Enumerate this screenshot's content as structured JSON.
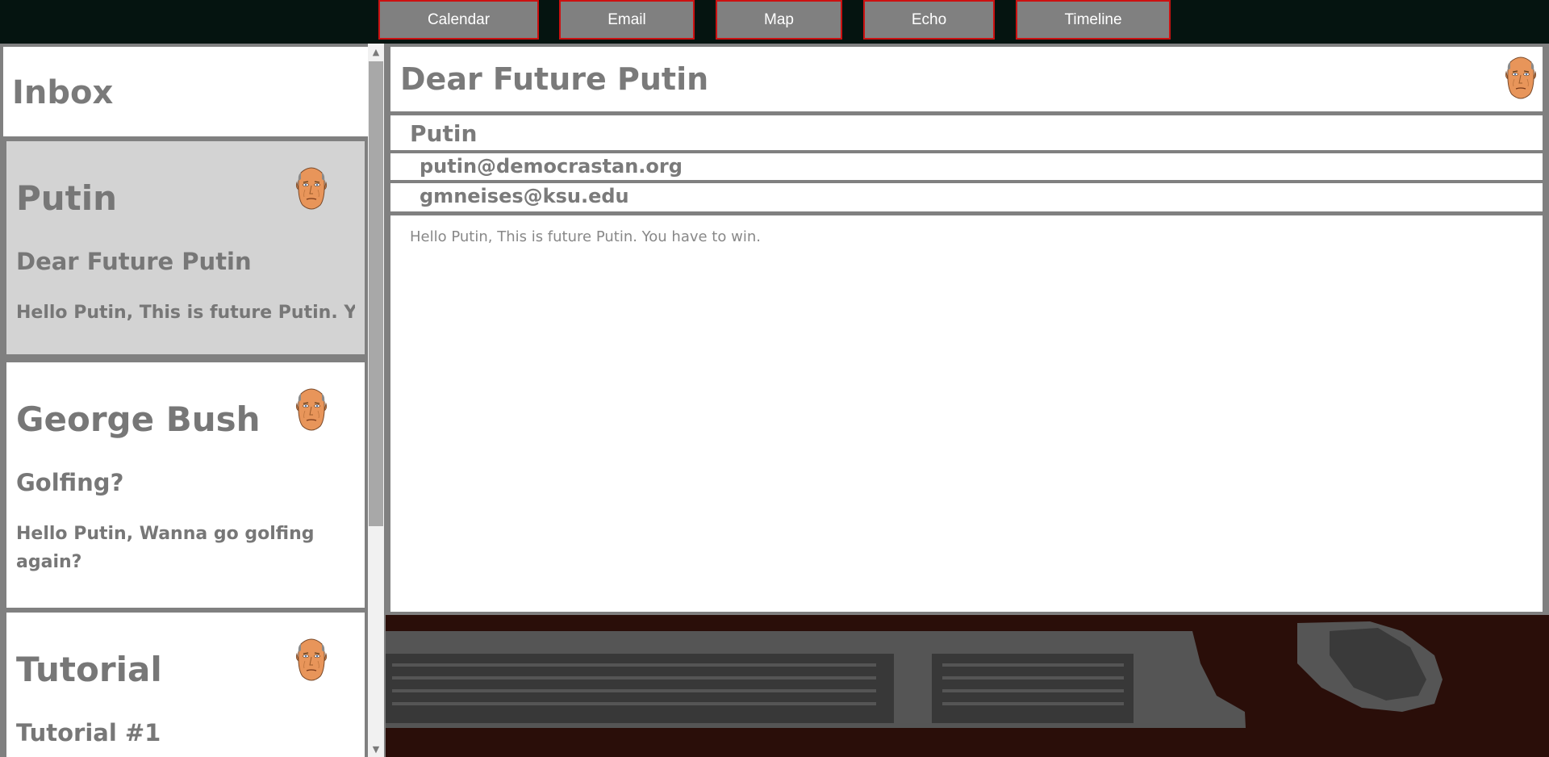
{
  "nav": {
    "items": [
      {
        "label": "Calendar"
      },
      {
        "label": "Email"
      },
      {
        "label": "Map"
      },
      {
        "label": "Echo"
      },
      {
        "label": "Timeline"
      }
    ],
    "accent": "#cc1111"
  },
  "inbox": {
    "title": "Inbox",
    "emails": [
      {
        "sender": "Putin",
        "subject": "Dear Future Putin",
        "preview": "Hello Putin, This is future Putin. Yo",
        "selected": true,
        "avatar": "putin-face-icon"
      },
      {
        "sender": "George Bush",
        "subject": "Golfing?",
        "preview": "Hello Putin, Wanna go golfing again?",
        "selected": false,
        "avatar": "putin-face-icon"
      },
      {
        "sender": "Tutorial",
        "subject": "Tutorial #1",
        "preview": "",
        "selected": false,
        "avatar": "putin-face-icon"
      }
    ]
  },
  "email": {
    "subject": "Dear Future Putin",
    "from_name": "Putin",
    "from_address": "putin@democrastan.org",
    "to_address": "gmneises@ksu.edu",
    "body": "Hello Putin, This is future Putin. You have to win.",
    "avatar": "putin-face-icon"
  },
  "colors": {
    "background": "#051410",
    "panel_border": "#808080",
    "selected_card": "#d3d3d3",
    "desk": "#2a0e09"
  }
}
